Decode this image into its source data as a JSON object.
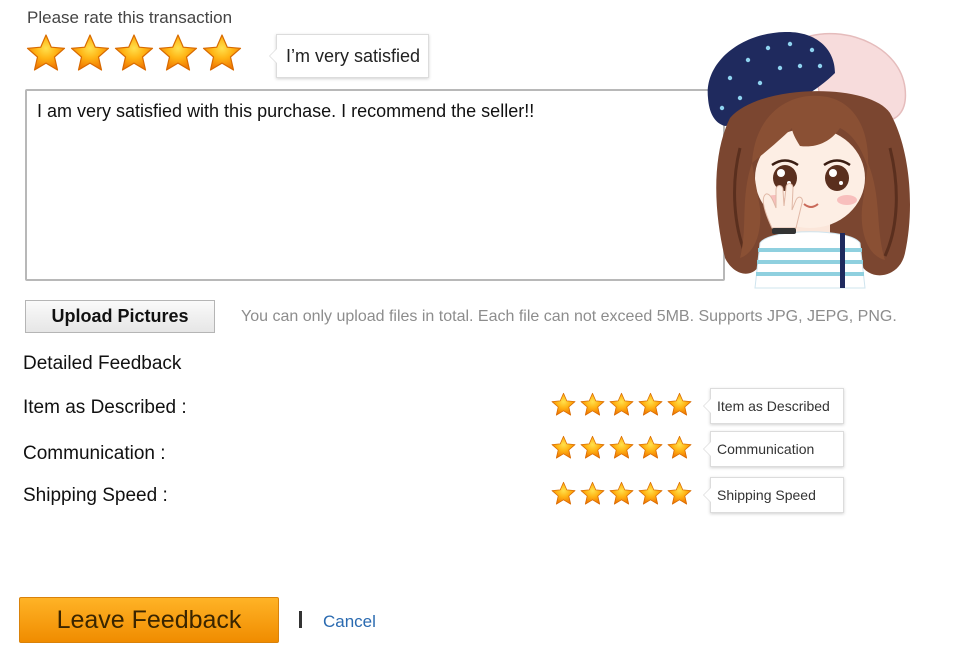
{
  "rating": {
    "prompt": "Please rate this transaction",
    "stars_total": 5,
    "stars_filled": 5,
    "tooltip": "I’m very satisfied"
  },
  "feedback": {
    "text": "I am very satisfied with this purchase. I recommend the seller!!"
  },
  "upload": {
    "button_label": "Upload Pictures",
    "note": "You can only upload files in total. Each file can not exceed 5MB. Supports JPG, JEPG, PNG."
  },
  "detailed": {
    "heading": "Detailed Feedback",
    "rows": [
      {
        "label": "Item as Described :",
        "tooltip": "Item as Described",
        "stars_filled": 5,
        "stars_total": 5
      },
      {
        "label": "Communication :",
        "tooltip": "Communication",
        "stars_filled": 5,
        "stars_total": 5
      },
      {
        "label": "Shipping Speed :",
        "tooltip": "Shipping Speed",
        "stars_filled": 5,
        "stars_total": 5
      }
    ]
  },
  "actions": {
    "submit_label": "Leave Feedback",
    "cancel_label": "Cancel"
  },
  "colors": {
    "star_light": "#ffc21a",
    "star_dark": "#f07d00",
    "button_orange": "#f7a010",
    "link_blue": "#2a6ab0"
  },
  "icons": {
    "star": "star-icon",
    "illustration": "cartoon-girl-illustration"
  }
}
